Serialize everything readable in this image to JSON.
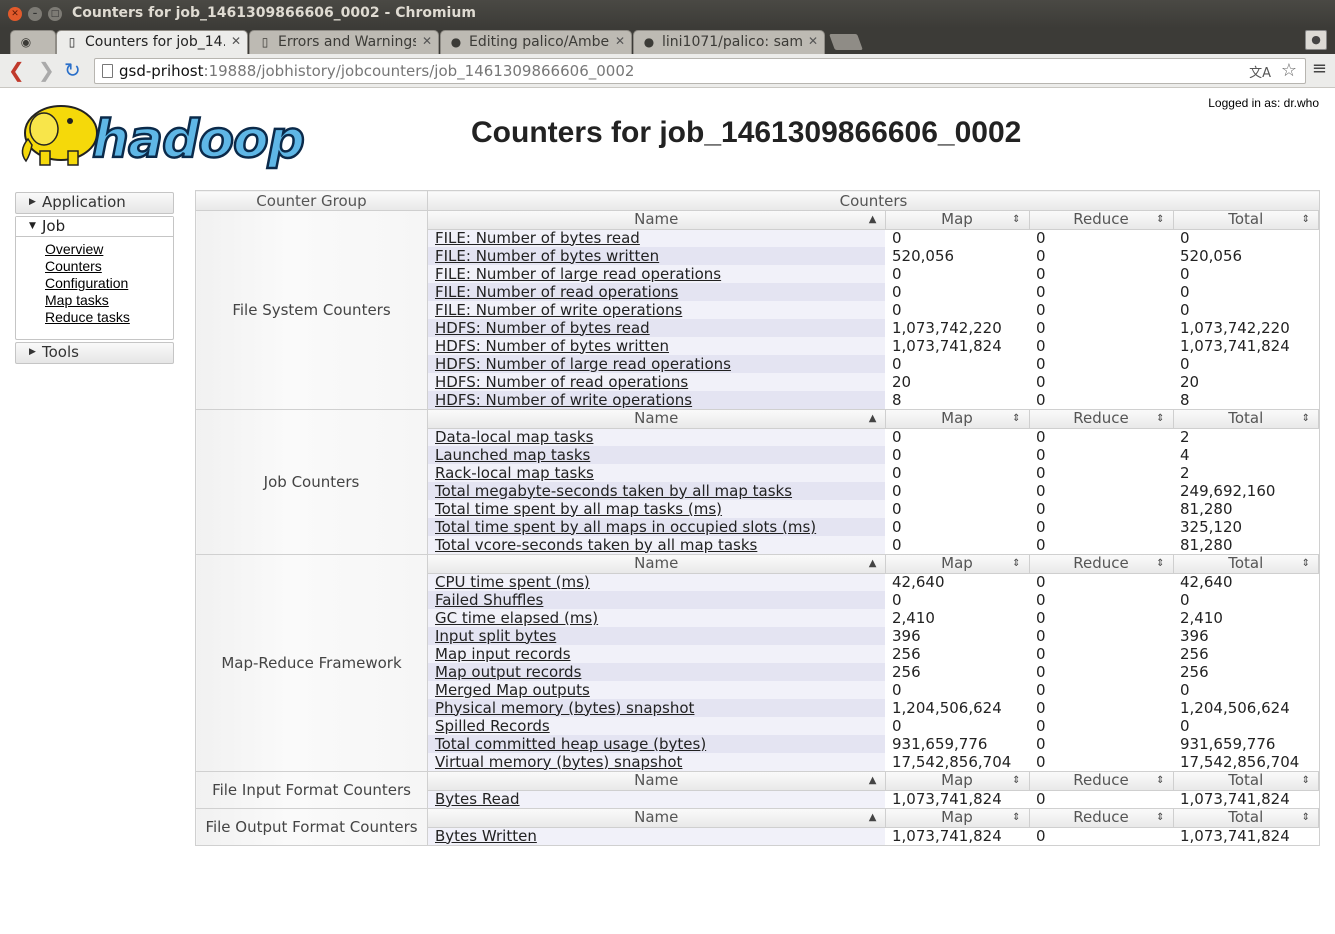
{
  "window": {
    "title": "Counters for job_1461309866606_0002 - Chromium"
  },
  "tabs": [
    {
      "label": "Counters for job_14…",
      "icon": "page-icon",
      "active": true
    },
    {
      "label": "Errors and Warnings",
      "icon": "page-icon",
      "active": false
    },
    {
      "label": "Editing palico/Ambe",
      "icon": "github-icon",
      "active": false
    },
    {
      "label": "lini1071/palico: sam",
      "icon": "github-icon",
      "active": false
    }
  ],
  "address": {
    "host": "gsd-prihost",
    "rest": ":19888/jobhistory/jobcounters/job_1461309866606_0002"
  },
  "header": {
    "logged_in": "Logged in as: dr.who",
    "title": "Counters for job_1461309866606_0002",
    "logo_text": "hadoop"
  },
  "sidebar": {
    "application": "Application",
    "job": "Job",
    "job_links": [
      "Overview",
      "Counters",
      "Configuration",
      "Map tasks",
      "Reduce tasks"
    ],
    "tools": "Tools"
  },
  "table": {
    "header_group": "Counter Group",
    "header_counters": "Counters",
    "col_name": "Name",
    "col_map": "Map",
    "col_reduce": "Reduce",
    "col_total": "Total",
    "groups": [
      {
        "name": "File System Counters",
        "rows": [
          [
            "FILE: Number of bytes read",
            "0",
            "0",
            "0"
          ],
          [
            "FILE: Number of bytes written",
            "520,056",
            "0",
            "520,056"
          ],
          [
            "FILE: Number of large read operations",
            "0",
            "0",
            "0"
          ],
          [
            "FILE: Number of read operations",
            "0",
            "0",
            "0"
          ],
          [
            "FILE: Number of write operations",
            "0",
            "0",
            "0"
          ],
          [
            "HDFS: Number of bytes read",
            "1,073,742,220",
            "0",
            "1,073,742,220"
          ],
          [
            "HDFS: Number of bytes written",
            "1,073,741,824",
            "0",
            "1,073,741,824"
          ],
          [
            "HDFS: Number of large read operations",
            "0",
            "0",
            "0"
          ],
          [
            "HDFS: Number of read operations",
            "20",
            "0",
            "20"
          ],
          [
            "HDFS: Number of write operations",
            "8",
            "0",
            "8"
          ]
        ]
      },
      {
        "name": "Job Counters",
        "rows": [
          [
            "Data-local map tasks",
            "0",
            "0",
            "2"
          ],
          [
            "Launched map tasks",
            "0",
            "0",
            "4"
          ],
          [
            "Rack-local map tasks",
            "0",
            "0",
            "2"
          ],
          [
            "Total megabyte-seconds taken by all map tasks",
            "0",
            "0",
            "249,692,160"
          ],
          [
            "Total time spent by all map tasks (ms)",
            "0",
            "0",
            "81,280"
          ],
          [
            "Total time spent by all maps in occupied slots (ms)",
            "0",
            "0",
            "325,120"
          ],
          [
            "Total vcore-seconds taken by all map tasks",
            "0",
            "0",
            "81,280"
          ]
        ]
      },
      {
        "name": "Map-Reduce Framework",
        "rows": [
          [
            "CPU time spent (ms)",
            "42,640",
            "0",
            "42,640"
          ],
          [
            "Failed Shuffles",
            "0",
            "0",
            "0"
          ],
          [
            "GC time elapsed (ms)",
            "2,410",
            "0",
            "2,410"
          ],
          [
            "Input split bytes",
            "396",
            "0",
            "396"
          ],
          [
            "Map input records",
            "256",
            "0",
            "256"
          ],
          [
            "Map output records",
            "256",
            "0",
            "256"
          ],
          [
            "Merged Map outputs",
            "0",
            "0",
            "0"
          ],
          [
            "Physical memory (bytes) snapshot",
            "1,204,506,624",
            "0",
            "1,204,506,624"
          ],
          [
            "Spilled Records",
            "0",
            "0",
            "0"
          ],
          [
            "Total committed heap usage (bytes)",
            "931,659,776",
            "0",
            "931,659,776"
          ],
          [
            "Virtual memory (bytes) snapshot",
            "17,542,856,704",
            "0",
            "17,542,856,704"
          ]
        ]
      },
      {
        "name": "File Input Format Counters",
        "rows": [
          [
            "Bytes Read",
            "1,073,741,824",
            "0",
            "1,073,741,824"
          ]
        ]
      },
      {
        "name": "File Output Format Counters",
        "rows": [
          [
            "Bytes Written",
            "1,073,741,824",
            "0",
            "1,073,741,824"
          ]
        ]
      }
    ]
  }
}
